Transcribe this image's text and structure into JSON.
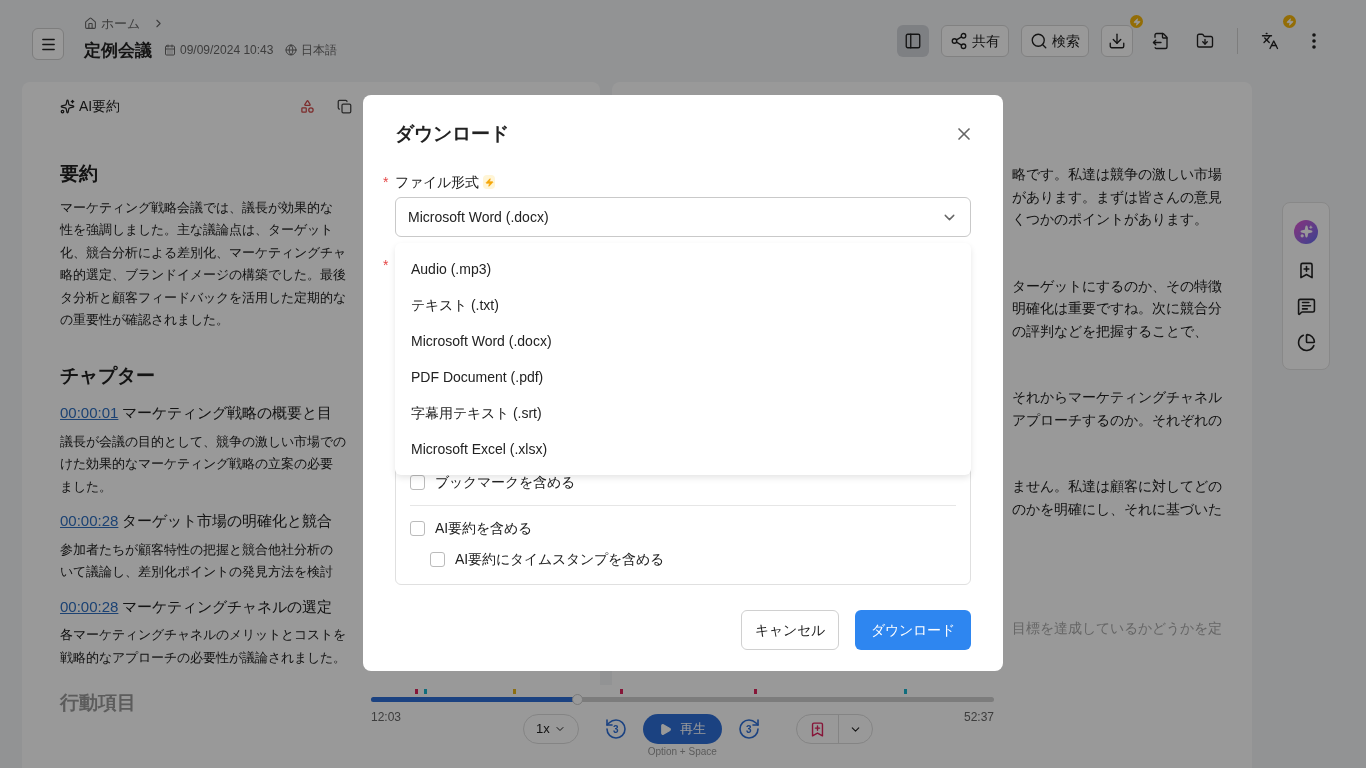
{
  "header": {
    "breadcrumb": "ホーム",
    "title": "定例会議",
    "date": "09/09/2024 10:43",
    "language": "日本語",
    "toolbar": [
      {
        "kind": "panel",
        "selected": true
      },
      {
        "kind": "share",
        "label": "共有",
        "selected": false
      },
      {
        "kind": "search",
        "label": "検索",
        "selected": false
      },
      {
        "kind": "download",
        "badge": true,
        "selected": false
      },
      {
        "kind": "export",
        "selected": false
      },
      {
        "kind": "folder",
        "selected": false
      },
      {
        "kind": "translate",
        "badge": true,
        "selected": false
      },
      {
        "kind": "more",
        "selected": false
      }
    ]
  },
  "summary_panel": {
    "tab": "AI要約",
    "heading": "要約",
    "summary_lines": [
      "マーケティング戦略会議では、議長が効果的な",
      "性を強調しました。主な議論点は、ターゲット",
      "化、競合分析による差別化、マーケティングチャ",
      "略的選定、ブランドイメージの構築でした。最後",
      "タ分析と顧客フィードバックを活用した定期的な",
      "の重要性が確認されました。"
    ],
    "chapters_heading": "チャプター",
    "chapters": [
      {
        "time": "00:00:01",
        "title": "マーケティング戦略の概要と目",
        "lines": [
          "議長が会議の目的として、競争の激しい市場での",
          "けた効果的なマーケティング戦略の立案の必要",
          "ました。"
        ]
      },
      {
        "time": "00:00:28",
        "title": "ターゲット市場の明確化と競合",
        "lines": [
          "参加者たちが顧客特性の把握と競合他社分析の",
          "いて議論し、差別化ポイントの発見方法を検討"
        ]
      },
      {
        "time": "00:00:28",
        "title": "マーケティングチャネルの選定",
        "lines": [
          "各マーケティングチャネルのメリットとコストを",
          "戦略的なアプローチの必要性が議論されました。"
        ]
      }
    ],
    "action_heading": "行動項目"
  },
  "transcript": {
    "paragraphs": [
      [
        "略です。私達は競争の激しい市場",
        "があります。まずは皆さんの意見",
        "くつかのポイントがあります。"
      ],
      [
        "ターゲットにするのか、その特徴",
        "明確化は重要ですね。次に競合分",
        "の評判などを把握することで、"
      ],
      [
        "それからマーケティングチャネル",
        "アプローチするのか。それぞれの"
      ],
      [
        "ません。私達は顧客に対してどの",
        "のかを明確にし、それに基づいた"
      ],
      [
        "目標を達成しているかどうかを定"
      ]
    ]
  },
  "player": {
    "level": 0.33,
    "current": "12:03",
    "total": "52:37",
    "speed": "1x",
    "skip_back": "3",
    "play": "再生",
    "skip_forward": "3",
    "shortcut": "Option + Space",
    "markers": [
      {
        "level": 0.07,
        "color": "#861638"
      },
      {
        "level": 0.085,
        "color": "#0f6d7d"
      },
      {
        "level": 0.228,
        "color": "#8c6e10"
      },
      {
        "level": 0.399,
        "color": "#861638"
      },
      {
        "level": 0.615,
        "color": "#861638"
      },
      {
        "level": 0.855,
        "color": "#0f6d7d"
      }
    ]
  },
  "dialog": {
    "title": "ダウンロード",
    "format_field": {
      "required_mark": "*",
      "label": "ファイル形式",
      "value": "Microsoft Word (.docx)",
      "expanded": true
    },
    "second_field": {
      "required_mark": "*"
    },
    "options": [
      "Audio (.mp3)",
      "テキスト (.txt)",
      "Microsoft Word (.docx)",
      "PDF Document (.pdf)",
      "字幕用テキスト (.srt)",
      "Microsoft Excel (.xlsx)"
    ],
    "checkboxes": [
      {
        "label": "ブックマークを含める",
        "checked": false
      },
      {
        "label": "AI要約を含める",
        "checked": false,
        "children": [
          {
            "label": "AI要約にタイムスタンプを含める",
            "checked": false
          }
        ]
      }
    ],
    "buttons": {
      "cancel": "キャンセル",
      "confirm": "ダウンロード"
    }
  }
}
